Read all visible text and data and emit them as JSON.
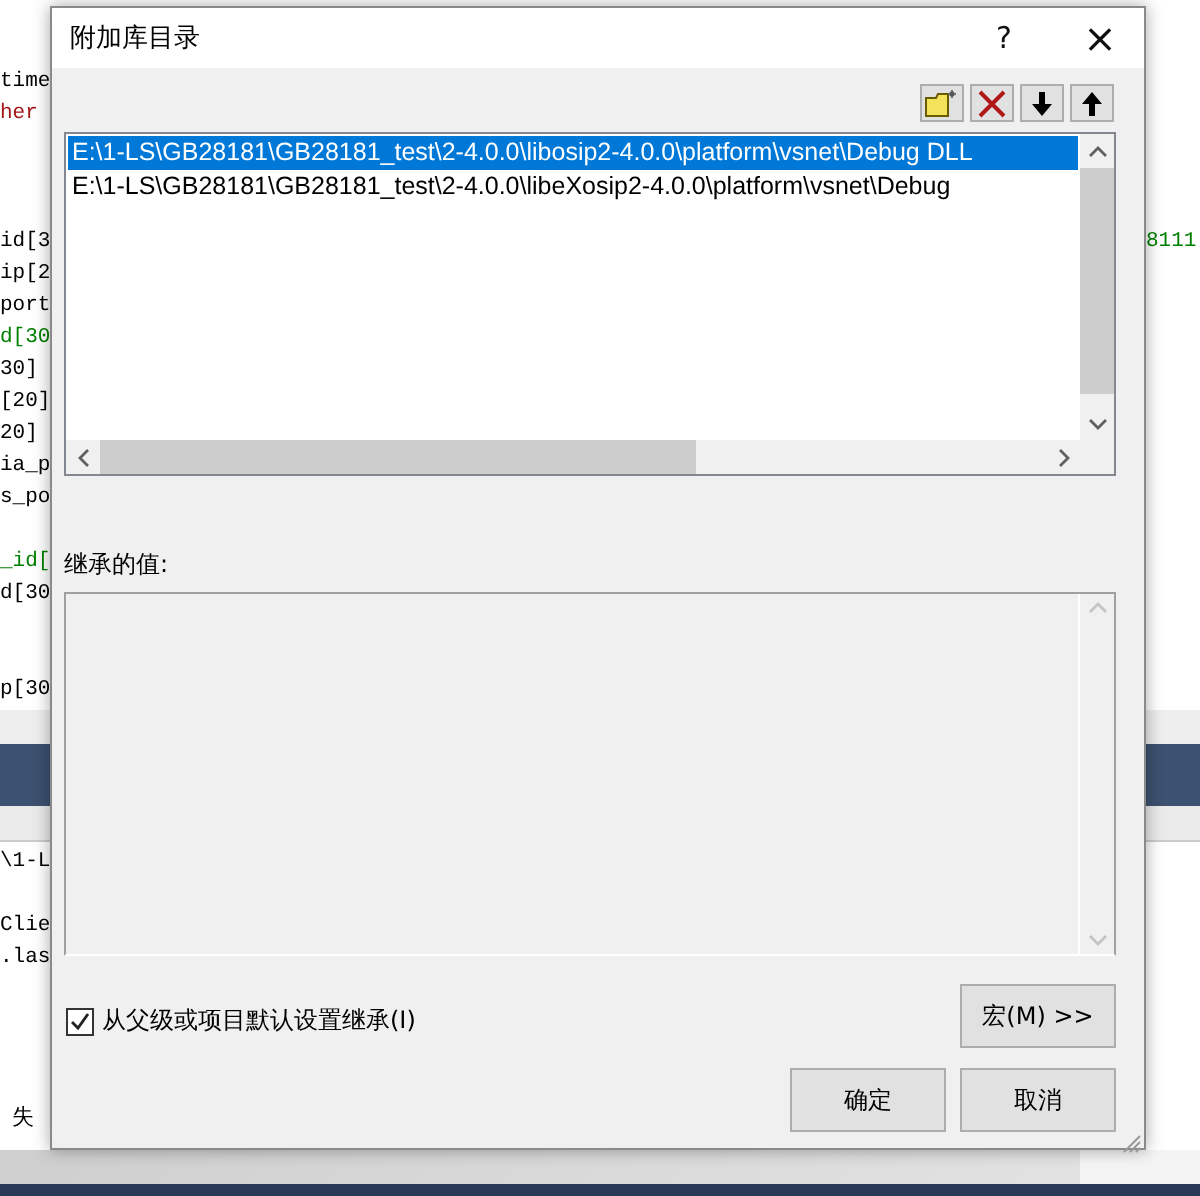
{
  "background_editor": {
    "upper_lines": [
      {
        "text": "time",
        "kind": "plain"
      },
      {
        "text": "her",
        "kind": "string"
      },
      {
        "kind": "blank"
      },
      {
        "kind": "blank"
      },
      {
        "kind": "blank"
      },
      {
        "text": "id[3",
        "kind": "plain"
      },
      {
        "text": "ip[2",
        "kind": "plain"
      },
      {
        "text": "port",
        "kind": "plain"
      },
      {
        "text": "d[30",
        "kind": "comment"
      },
      {
        "text": "30]",
        "kind": "plain"
      },
      {
        "text": "[20]",
        "kind": "plain"
      },
      {
        "text": "20]",
        "kind": "plain"
      },
      {
        "text": "ia_p",
        "kind": "plain"
      },
      {
        "text": "s_po",
        "kind": "plain"
      },
      {
        "kind": "blank"
      },
      {
        "text": "_id[",
        "kind": "comment"
      },
      {
        "text": "d[30",
        "kind": "plain"
      },
      {
        "kind": "blank"
      },
      {
        "kind": "blank"
      },
      {
        "text": "p[30",
        "kind": "plain"
      }
    ],
    "right_text": "8111",
    "lower_lines": [
      {
        "text": "\\1-L",
        "kind": "plain"
      },
      {
        "kind": "blank"
      },
      {
        "text": "Clie",
        "kind": "plain"
      },
      {
        "text": ".las",
        "kind": "plain"
      },
      {
        "kind": "blank"
      },
      {
        "kind": "blank"
      },
      {
        "kind": "blank"
      },
      {
        "kind": "blank"
      },
      {
        "text": "失",
        "kind": "message"
      }
    ]
  },
  "dialog": {
    "title": "附加库目录",
    "help_button": "?",
    "close_button": "×",
    "directories": [
      {
        "text": "E:\\1-LS\\GB28181\\GB28181_test\\2-4.0.0\\libosip2-4.0.0\\platform\\vsnet\\Debug DLL",
        "selected": true
      },
      {
        "text": "E:\\1-LS\\GB28181\\GB28181_test\\2-4.0.0\\libeXosip2-4.0.0\\platform\\vsnet\\Debug",
        "selected": false
      }
    ],
    "inherited_label": "继承的值:",
    "inherit_checkbox": {
      "label": "从父级或项目默认设置继承(I)",
      "checked": true
    },
    "macro_button": "宏(M) >>",
    "buttons": [
      "确定",
      "取消"
    ]
  }
}
